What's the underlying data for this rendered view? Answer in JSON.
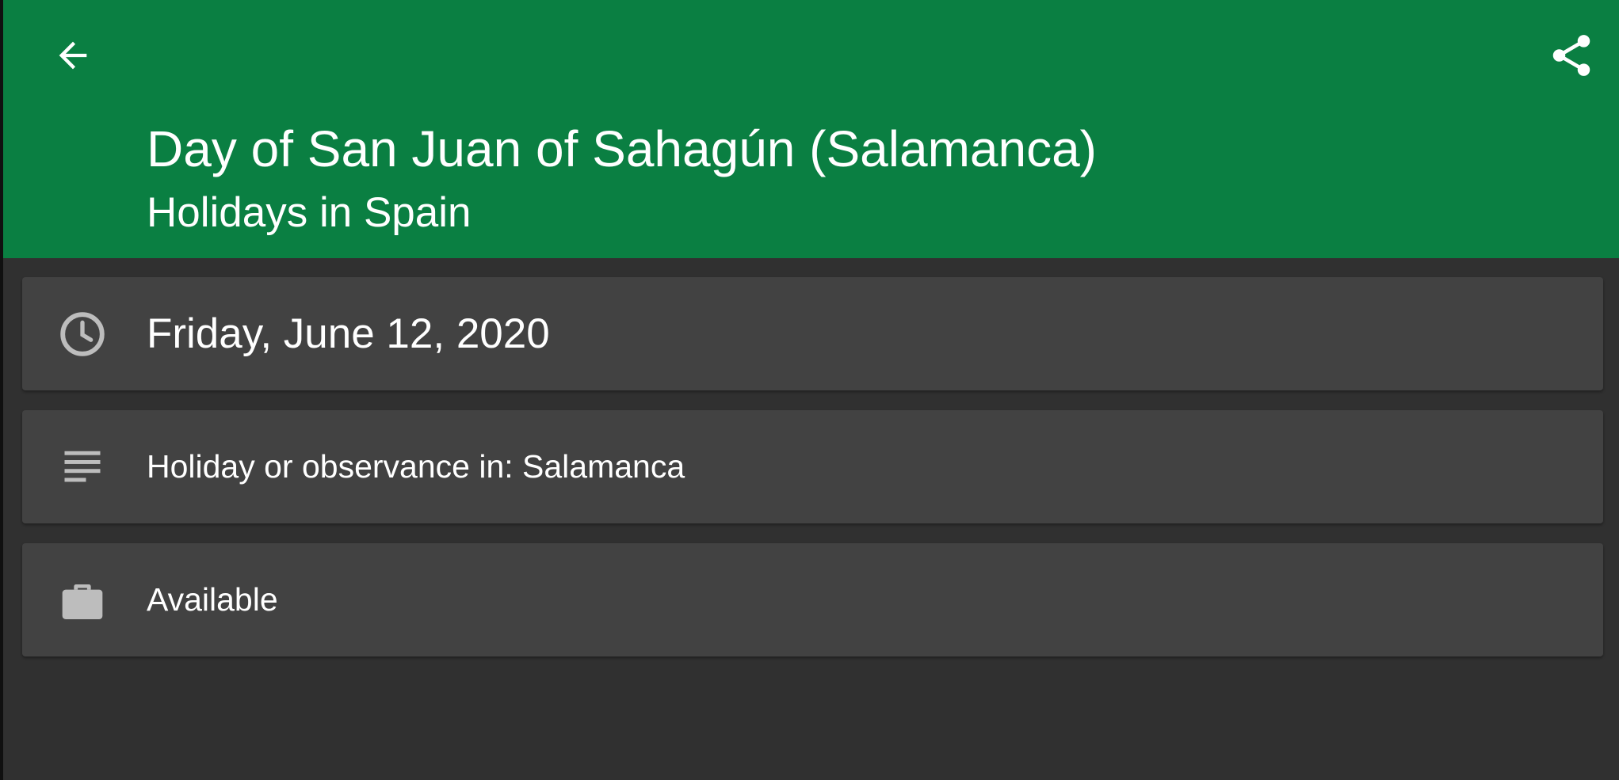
{
  "header": {
    "title": "Day of San Juan of Sahagún (Salamanca)",
    "subtitle": "Holidays in Spain",
    "back_icon": "arrow-back-icon",
    "share_icon": "share-icon",
    "background_color": "#0a7f42"
  },
  "details": {
    "date": {
      "icon": "clock-icon",
      "text": "Friday, June 12, 2020"
    },
    "description": {
      "icon": "notes-icon",
      "text": "Holiday or observance in: Salamanca"
    },
    "availability": {
      "icon": "briefcase-icon",
      "text": "Available"
    }
  },
  "colors": {
    "background": "#303030",
    "card": "#424242",
    "icon": "#bdbdbd"
  }
}
